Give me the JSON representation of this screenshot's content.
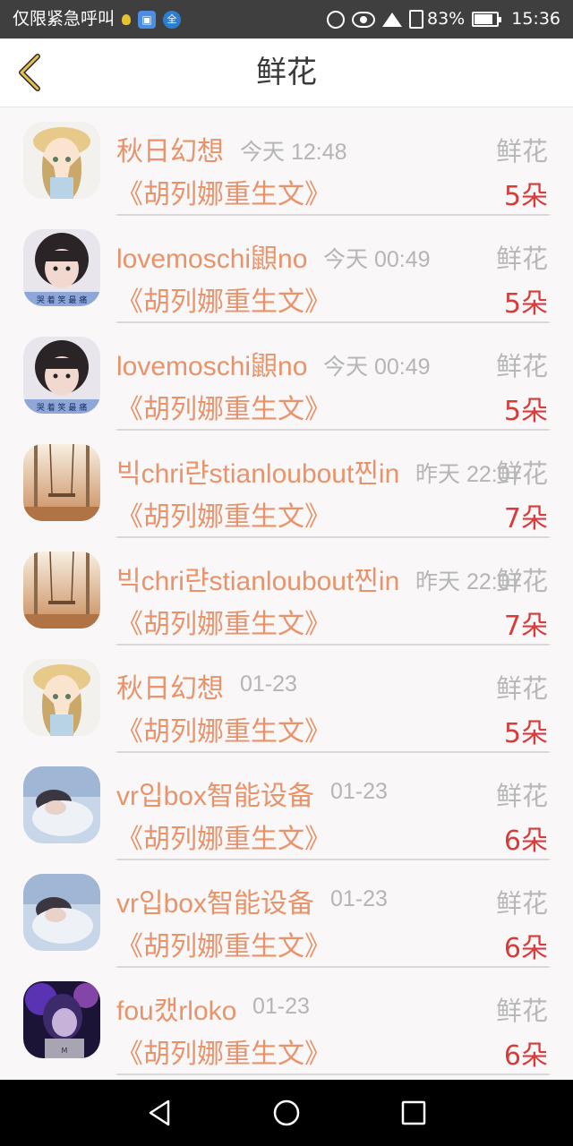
{
  "status_bar": {
    "carrier_text": "仅限紧急呼叫",
    "battery": "83%",
    "time": "15:36",
    "icons": [
      "bulb-icon",
      "app-icon",
      "quanmin-icon",
      "sync-icon",
      "eye-icon",
      "wifi-icon",
      "sim-icon",
      "battery-icon"
    ],
    "app2_glyph": "全"
  },
  "header": {
    "title": "鲜花",
    "back_icon": "chevron-left-icon"
  },
  "colors": {
    "name": "#e8936a",
    "count": "#d93a3a",
    "muted": "#b5b5b5",
    "back_icon": "#ecc24a"
  },
  "rows": [
    {
      "name": "秋日幻想",
      "time": "今天 12:48",
      "type": "鲜花",
      "book": "《胡列娜重生文》",
      "count": "5朵",
      "avatar": "anime-girl"
    },
    {
      "name": "lovemoschi鼰no",
      "time": "今天 00:49",
      "type": "鲜花",
      "book": "《胡列娜重生文》",
      "count": "5朵",
      "avatar": "girl-photo"
    },
    {
      "name": "lovemoschi鼰no",
      "time": "今天 00:49",
      "type": "鲜花",
      "book": "《胡列娜重生文》",
      "count": "5朵",
      "avatar": "girl-photo"
    },
    {
      "name": "빅chri랸stianloubout찐in",
      "time": "昨天 22:07",
      "type": "鲜花",
      "book": "《胡列娜重生文》",
      "count": "7朵",
      "avatar": "swing"
    },
    {
      "name": "빅chri랸stianloubout찐in",
      "time": "昨天 22:07",
      "type": "鲜花",
      "book": "《胡列娜重生文》",
      "count": "7朵",
      "avatar": "swing"
    },
    {
      "name": "秋日幻想",
      "time": "01-23",
      "type": "鲜花",
      "book": "《胡列娜重生文》",
      "count": "5朵",
      "avatar": "anime-girl"
    },
    {
      "name": "vr입box智能设备",
      "time": "01-23",
      "type": "鲜花",
      "book": "《胡列娜重生文》",
      "count": "6朵",
      "avatar": "resting-girl"
    },
    {
      "name": "vr입box智能设备",
      "time": "01-23",
      "type": "鲜花",
      "book": "《胡列娜重生文》",
      "count": "6朵",
      "avatar": "resting-girl"
    },
    {
      "name": "fou캤rloko",
      "time": "01-23",
      "type": "鲜花",
      "book": "《胡列娜重生文》",
      "count": "6朵",
      "avatar": "purple-girl"
    }
  ],
  "nav_bar": {
    "back": "back-triangle-icon",
    "home": "home-circle-icon",
    "recents": "recents-square-icon"
  }
}
